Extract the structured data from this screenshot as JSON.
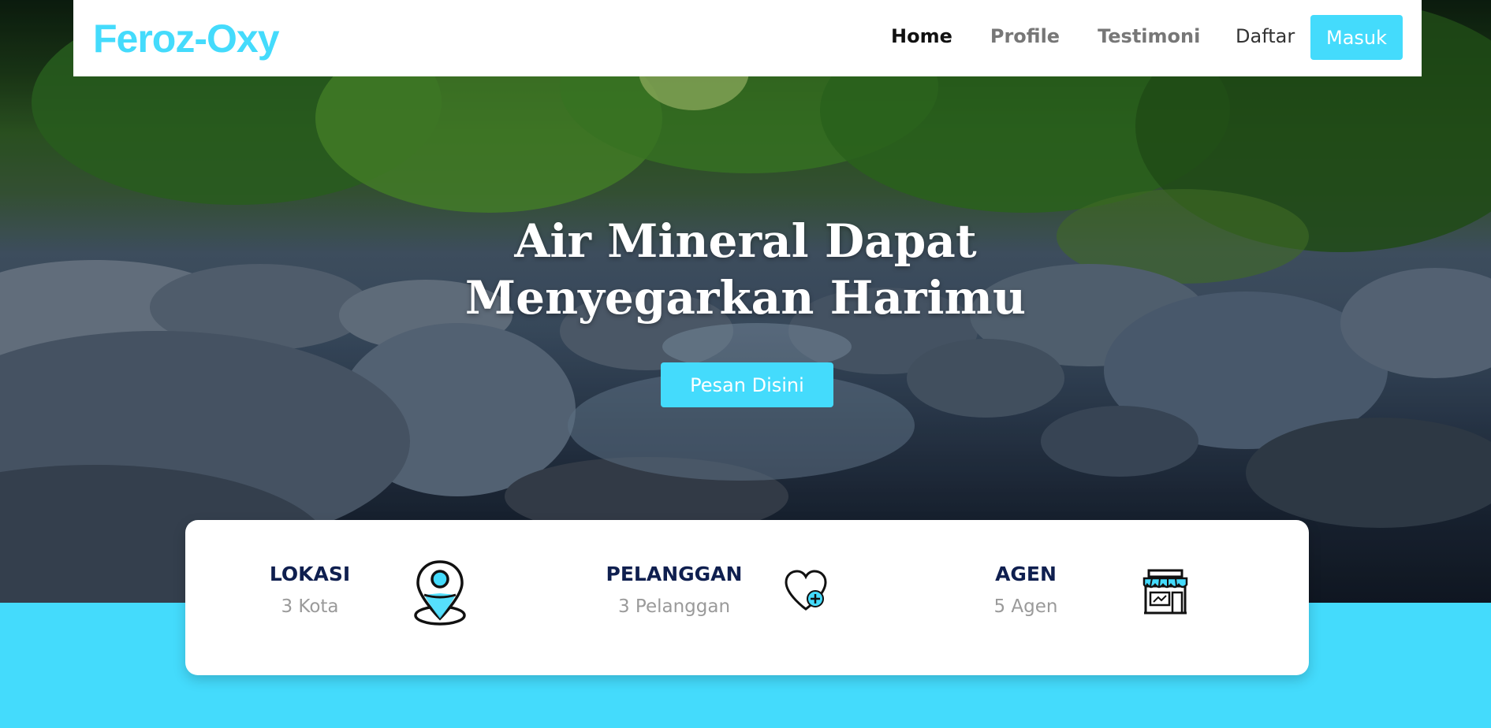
{
  "brand": "Feroz-Oxy",
  "nav": {
    "home": "Home",
    "profile": "Profile",
    "testimoni": "Testimoni",
    "daftar": "Daftar",
    "masuk": "Masuk"
  },
  "hero": {
    "title_line1": "Air Mineral Dapat",
    "title_line2": "Menyegarkan Harimu",
    "cta": "Pesan Disini"
  },
  "stats": [
    {
      "title": "LOKASI",
      "value": "3 Kota",
      "icon": "location-pin-icon"
    },
    {
      "title": "PELANGGAN",
      "value": "3 Pelanggan",
      "icon": "heart-plus-icon"
    },
    {
      "title": "AGEN",
      "value": "5 Agen",
      "icon": "store-icon"
    }
  ],
  "colors": {
    "accent": "#44dbfc",
    "heading": "#0f1f4f",
    "muted": "#9a9a9a"
  }
}
